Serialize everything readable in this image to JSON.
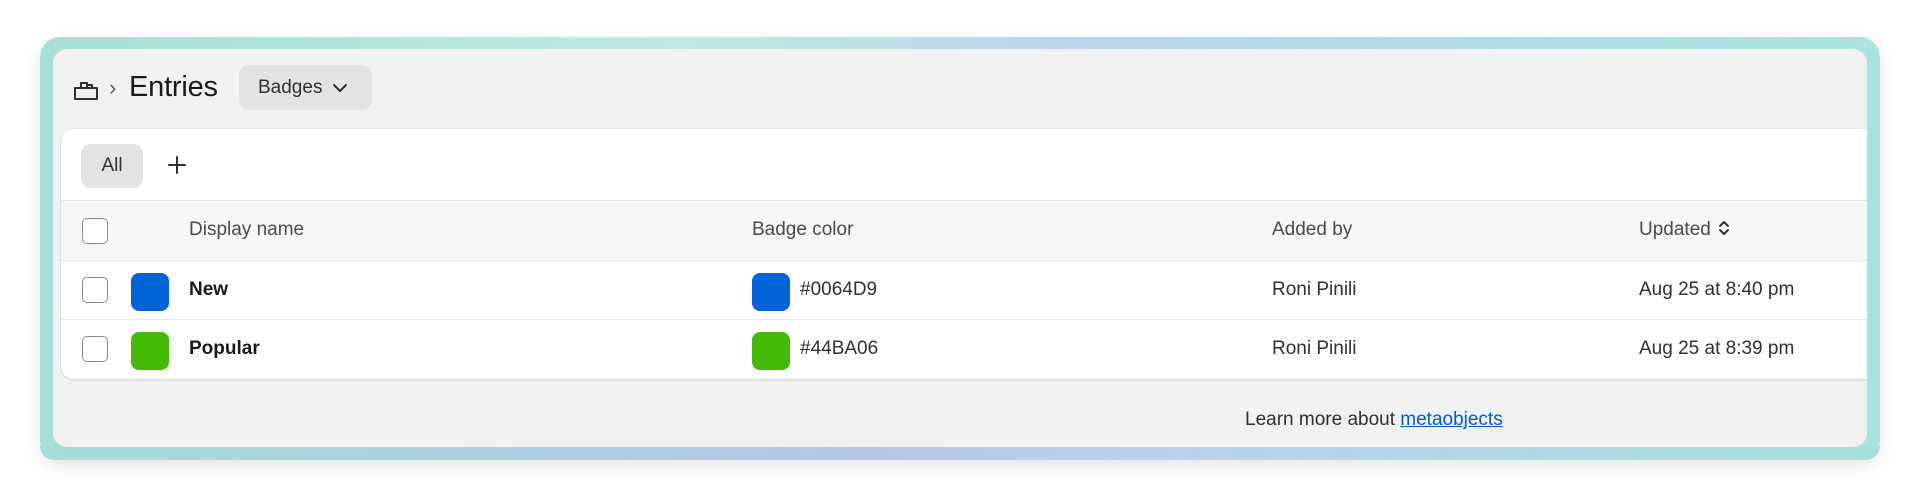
{
  "header": {
    "title": "Entries",
    "breadcrumb_separator": "›",
    "type_select_label": "Badges"
  },
  "tabs": [
    {
      "label": "All",
      "selected": true
    }
  ],
  "table": {
    "columns": [
      "Display name",
      "Badge color",
      "Added by",
      "Updated"
    ],
    "sort_column": "Updated",
    "rows": [
      {
        "display_name": "New",
        "badge_color": "#0064D9",
        "added_by": "Roni Pinili",
        "updated": "Aug 25 at 8:40 pm"
      },
      {
        "display_name": "Popular",
        "badge_color": "#44BA06",
        "added_by": "Roni Pinili",
        "updated": "Aug 25 at 8:39 pm"
      }
    ]
  },
  "footer": {
    "text": "Learn more about ",
    "link_label": "metaobjects"
  },
  "icons": {
    "home": "store-icon",
    "chevron": "chevron-down-icon",
    "add": "plus-icon",
    "sort": "sort-icon"
  },
  "colors": {
    "row1_swatch": "#0064D9",
    "row2_swatch": "#44BA06",
    "link": "#005BD3"
  }
}
